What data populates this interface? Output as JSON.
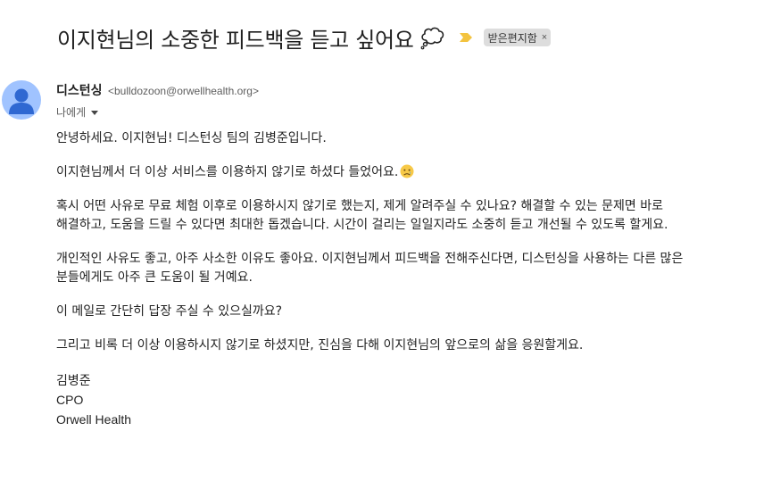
{
  "email": {
    "subject": "이지현님의 소중한 피드백을 듣고 싶어요",
    "label": "받은편지함",
    "label_close": "×",
    "sender_name": "디스턴싱",
    "sender_email": "<bulldozoon@orwellhealth.org>",
    "recipient": "나에게",
    "body": {
      "greeting": "안녕하세요. 이지현님! 디스턴싱 팀의 김병준입니다.",
      "p1": "이지현님께서 더 이상 서비스를 이용하지 않기로 하셨다 들었어요.",
      "p2_line1": "혹시 어떤 사유로 무료 체험 이후로 이용하시지 않기로 했는지, 제게 알려주실 수 있나요? 해결할 수 있는 문제면 바로",
      "p2_line2": "해결하고, 도움을 드릴 수 있다면 최대한 돕겠습니다. 시간이 걸리는 일일지라도 소중히 듣고 개선될 수 있도록 할게요.",
      "p3_line1": "개인적인 사유도 좋고, 아주 사소한 이유도 좋아요. 이지현님께서 피드백을 전해주신다면, 디스턴싱을 사용하는 다른 많은",
      "p3_line2": "분들에게도 아주 큰 도움이 될 거예요.",
      "p4": "이 메일로 간단히 답장 주실 수 있으실까요?",
      "p5": "그리고 비록 더 이상 이용하시지 않기로 하셨지만, 진심을 다해 이지현님의 앞으로의 삶을 응원할게요."
    },
    "signature": {
      "name": "김병준",
      "title": "CPO",
      "company": "Orwell Health"
    }
  },
  "icons": {
    "subject_emoji": "thought-balloon-icon",
    "importance": "importance-marker-icon",
    "body_emoji": "crying-face-icon",
    "avatar": "default-avatar-icon"
  },
  "colors": {
    "avatar_bg": "#a0c3ff",
    "avatar_figure": "#2f68d2",
    "importance": "#f3c33f",
    "label_chip_bg": "#dddddd"
  }
}
